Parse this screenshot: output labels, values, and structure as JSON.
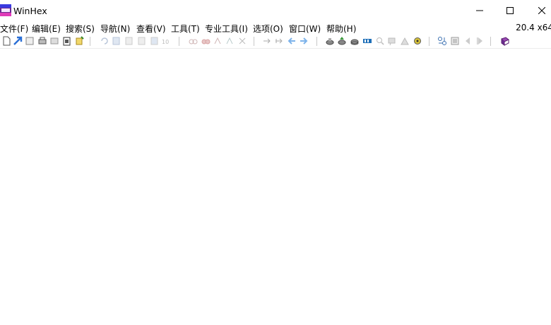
{
  "window": {
    "title": "WinHex"
  },
  "menu": {
    "items": [
      "文件(F)",
      "编辑(E)",
      "搜索(S)",
      "导航(N)",
      "查看(V)",
      "工具(T)",
      "专业工具(I)",
      "选项(O)",
      "窗口(W)",
      "帮助(H)"
    ],
    "version": "20.4 x64"
  },
  "toolbar": {
    "icons": [
      "new-file-icon",
      "open-file-icon",
      "save-icon",
      "print-icon",
      "properties-icon",
      "paste-icon",
      "edit-icon",
      "undo-icon",
      "cut-icon",
      "copy-icon",
      "paste-block-icon",
      "copy-block-icon",
      "write-block-icon",
      "find-text-icon",
      "find-hex-icon",
      "replace-text-icon",
      "replace-hex-icon",
      "find-again-icon",
      "goto-offset-icon",
      "goto-sector-icon",
      "back-arrow-icon",
      "forward-arrow-icon",
      "open-disk-icon",
      "restore-image-icon",
      "clone-disk-icon",
      "ram-editor-icon",
      "search-icon",
      "data-interpreter-icon",
      "directory-browser-icon",
      "gear-icon",
      "compare-icon",
      "template-icon",
      "previous-icon",
      "next-icon",
      "help-book-icon"
    ]
  }
}
